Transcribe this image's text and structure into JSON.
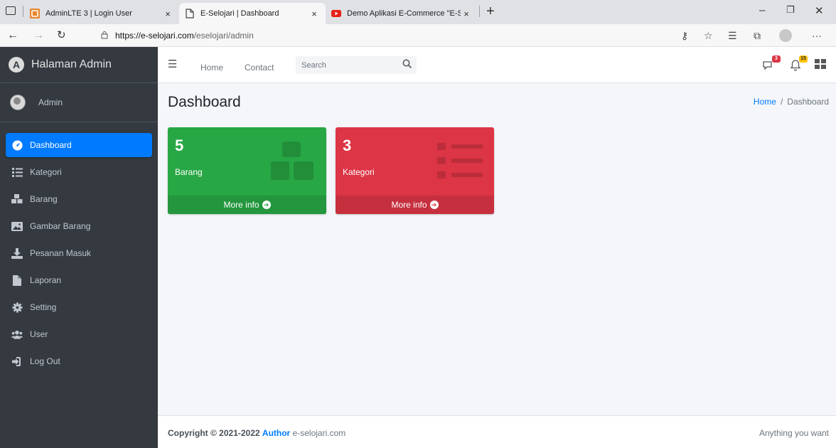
{
  "browser": {
    "tabs": [
      {
        "title": "AdminLTE 3 | Login User",
        "active": false,
        "favicon": "adminlte-icon"
      },
      {
        "title": "E-Selojari | Dashboard",
        "active": true,
        "favicon": "page-icon"
      },
      {
        "title": "Demo Aplikasi E-Commerce \"E-S",
        "active": false,
        "favicon": "youtube-icon"
      }
    ],
    "close_glyph": "×",
    "new_tab_glyph": "+",
    "url_host": "https://e-selojari.com",
    "url_path": "/eselojari/admin"
  },
  "sidebar": {
    "brand": "Halaman Admin",
    "brand_letter": "A",
    "user": "Admin",
    "items": [
      {
        "label": "Dashboard",
        "icon": "tachometer-icon",
        "active": true
      },
      {
        "label": "Kategori",
        "icon": "list-icon",
        "active": false
      },
      {
        "label": "Barang",
        "icon": "cubes-icon",
        "active": false
      },
      {
        "label": "Gambar Barang",
        "icon": "image-icon",
        "active": false
      },
      {
        "label": "Pesanan Masuk",
        "icon": "download-icon",
        "active": false
      },
      {
        "label": "Laporan",
        "icon": "file-icon",
        "active": false
      },
      {
        "label": "Setting",
        "icon": "gear-icon",
        "active": false
      },
      {
        "label": "User",
        "icon": "users-icon",
        "active": false
      },
      {
        "label": "Log Out",
        "icon": "sign-out-icon",
        "active": false
      }
    ]
  },
  "navbar": {
    "home": "Home",
    "contact": "Contact",
    "search_placeholder": "Search",
    "messages_count": "3",
    "notifications_count": "15"
  },
  "content": {
    "title": "Dashboard",
    "breadcrumb_home": "Home",
    "breadcrumb_sep": "/",
    "breadcrumb_current": "Dashboard",
    "boxes": [
      {
        "value": "5",
        "label": "Barang",
        "link": "More info",
        "color": "#28a745",
        "icon": "cubes-icon"
      },
      {
        "value": "3",
        "label": "Kategori",
        "link": "More info",
        "color": "#dc3545",
        "icon": "list-icon"
      }
    ]
  },
  "footer": {
    "copyright": "Copyright © 2021-2022",
    "author": "Author",
    "site": "e-selojari.com",
    "right": "Anything you want"
  }
}
